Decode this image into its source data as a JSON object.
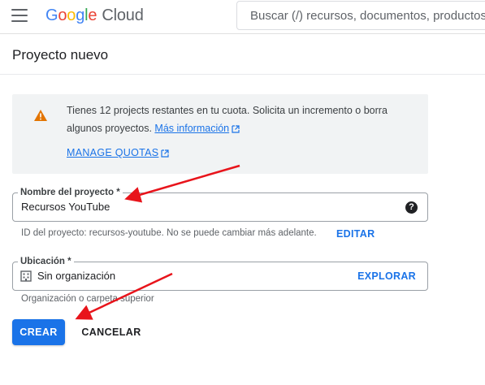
{
  "header": {
    "logo_google_letters": [
      "G",
      "o",
      "o",
      "g",
      "l",
      "e"
    ],
    "logo_product": "Cloud",
    "search_placeholder": "Buscar (/) recursos, documentos, productos"
  },
  "page": {
    "title": "Proyecto nuevo"
  },
  "notice": {
    "text": "Tienes 12 projects restantes en tu cuota. Solicita un incremento o borra algunos proyectos.",
    "more_info_link": "Más información",
    "manage_quotas_link": "MANAGE QUOTAS"
  },
  "project_name_field": {
    "label": "Nombre del proyecto *",
    "value": "Recursos YouTube",
    "help_icon_glyph": "?"
  },
  "project_id": {
    "hint": "ID del proyecto: recursos-youtube. No se puede cambiar más adelante.",
    "edit_label": "EDITAR"
  },
  "location_field": {
    "label": "Ubicación *",
    "value": "Sin organización",
    "explore_label": "EXPLORAR",
    "hint": "Organización o carpeta superior"
  },
  "actions": {
    "create_label": "CREAR",
    "cancel_label": "CANCELAR"
  },
  "colors": {
    "accent_blue": "#1a73e8",
    "warning_orange": "#e37400",
    "annotation_red": "#e8141b",
    "notice_bg": "#f1f3f4"
  },
  "icons": {
    "menu": "hamburger-menu-icon",
    "warning": "warning-triangle-icon",
    "external": "external-link-icon",
    "help": "help-circle-icon",
    "organization": "building-icon"
  }
}
